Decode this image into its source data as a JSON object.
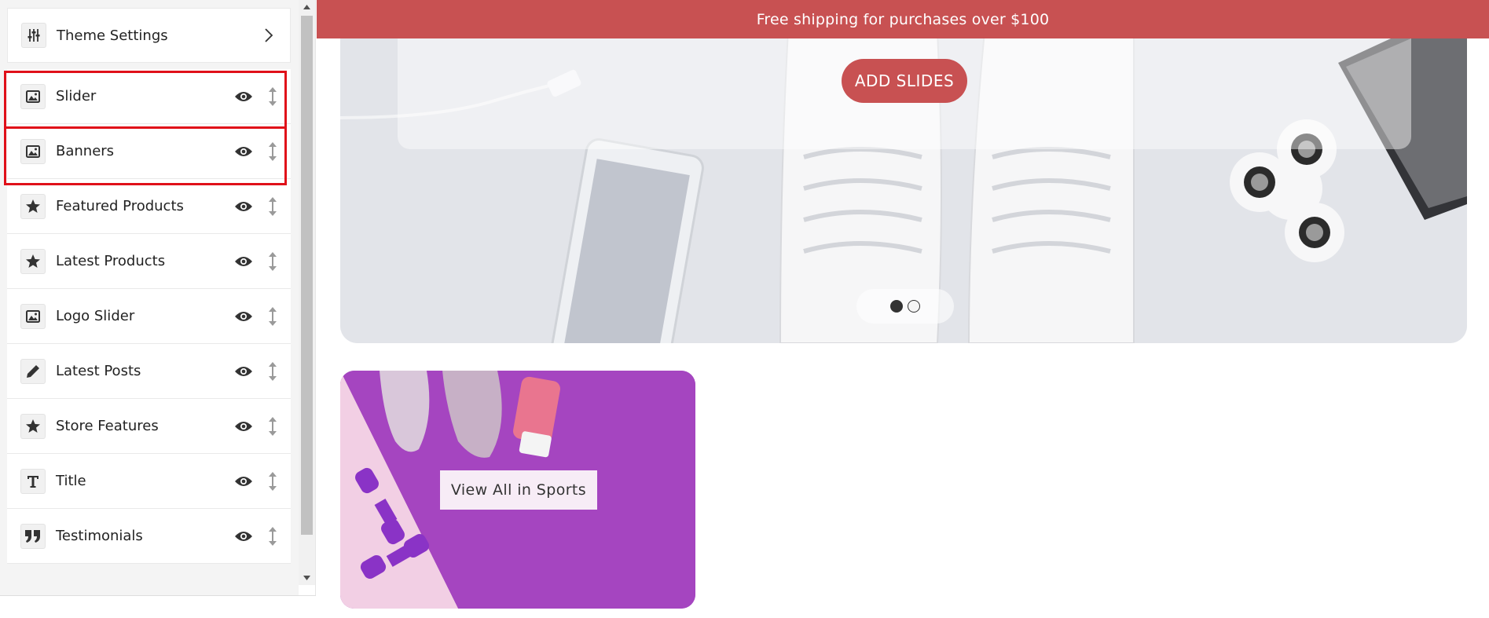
{
  "sidebar": {
    "theme_settings": {
      "label": "Theme Settings",
      "icon": "sliders-icon"
    },
    "sections": [
      {
        "label": "Slider",
        "icon": "image-icon"
      },
      {
        "label": "Banners",
        "icon": "image-icon"
      },
      {
        "label": "Featured Products",
        "icon": "star-icon"
      },
      {
        "label": "Latest Products",
        "icon": "star-icon"
      },
      {
        "label": "Logo Slider",
        "icon": "image-icon"
      },
      {
        "label": "Latest Posts",
        "icon": "pencil-icon"
      },
      {
        "label": "Store Features",
        "icon": "star-icon"
      },
      {
        "label": "Title",
        "icon": "text-icon"
      },
      {
        "label": "Testimonials",
        "icon": "quote-icon"
      }
    ]
  },
  "preview": {
    "announcement": "Free shipping for purchases over $100",
    "slider": {
      "add_slides_label": "ADD SLIDES"
    },
    "banner": {
      "button_label": "View All in Sports"
    }
  },
  "colors": {
    "brand": "#c85152",
    "highlight": "#e01019",
    "banner_bg": "#a044bd"
  }
}
